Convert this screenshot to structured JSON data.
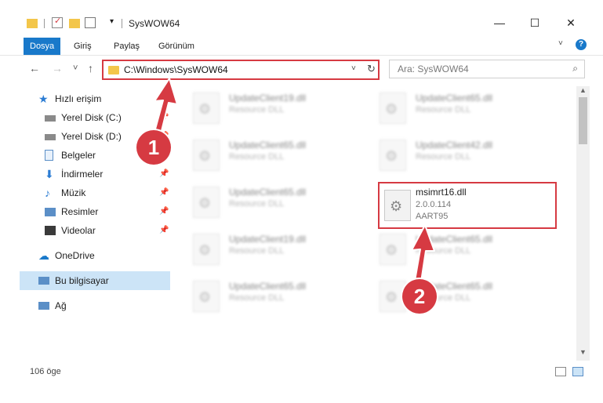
{
  "window": {
    "title": "SysWOW64",
    "minimize": "—",
    "maximize": "☐",
    "close": "✕"
  },
  "ribbon": {
    "tabs": [
      "Dosya",
      "Giriş",
      "Paylaş",
      "Görünüm"
    ],
    "help": "?"
  },
  "nav": {
    "back": "←",
    "forward": "→",
    "recent": "˅",
    "up": "↑",
    "address": "C:\\Windows\\SysWOW64",
    "address_dropdown": "˅",
    "refresh": "↻",
    "search_placeholder": "Ara: SysWOW64",
    "search_icon": "⌕"
  },
  "sidebar": {
    "items": [
      {
        "label": "Hızlı erişim",
        "icon": "star-icon"
      },
      {
        "label": "Yerel Disk (C:)",
        "icon": "drive-icon",
        "pinned": true
      },
      {
        "label": "Yerel Disk (D:)",
        "icon": "drive-icon",
        "pinned": true
      },
      {
        "label": "Belgeler",
        "icon": "documents-icon",
        "pinned": true
      },
      {
        "label": "İndirmeler",
        "icon": "download-icon",
        "pinned": true
      },
      {
        "label": "Müzik",
        "icon": "music-icon",
        "pinned": true
      },
      {
        "label": "Resimler",
        "icon": "pictures-icon",
        "pinned": true
      },
      {
        "label": "Videolar",
        "icon": "videos-icon",
        "pinned": true
      },
      {
        "label": "OneDrive",
        "icon": "cloud-icon"
      },
      {
        "label": "Bu bilgisayar",
        "icon": "computer-icon",
        "selected": true
      },
      {
        "label": "Ağ",
        "icon": "network-icon"
      }
    ]
  },
  "files": {
    "left": [
      {
        "name": "UpdateClient19.dll",
        "desc": "Resource DLL"
      },
      {
        "name": "UpdateClient65.dll",
        "desc": "Resource DLL"
      },
      {
        "name": "UpdateClient65.dll",
        "desc": "Resource DLL"
      },
      {
        "name": "UpdateClient19.dll",
        "desc": "Resource DLL"
      },
      {
        "name": "UpdateClient65.dll",
        "desc": "Resource DLL"
      }
    ],
    "right": [
      {
        "name": "UpdateClient65.dll",
        "desc": "Resource DLL"
      },
      {
        "name": "UpdateClient42.dll",
        "desc": "Resource DLL"
      },
      {
        "name": "UpdateClient65.dll",
        "desc": "Resource DLL"
      },
      {
        "name": "UpdateClient65.dll",
        "desc": "Resource DLL"
      }
    ],
    "highlighted": {
      "name": "msimrt16.dll",
      "version": "2.0.0.114",
      "company": "AART95"
    }
  },
  "status": {
    "count": "106 öge"
  },
  "annotations": {
    "step1": "1",
    "step2": "2"
  },
  "colors": {
    "accent": "#1979ca",
    "highlight": "#d63a42",
    "selected": "#cce4f7"
  }
}
